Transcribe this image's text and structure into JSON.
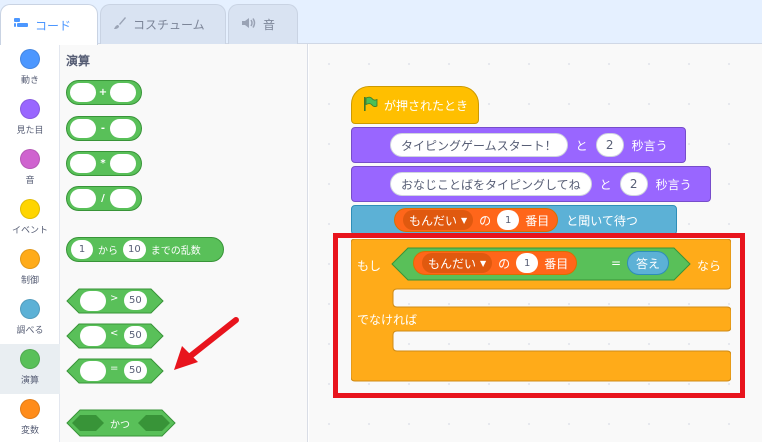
{
  "tabs": [
    {
      "label": "コード",
      "icon": "code-icon"
    },
    {
      "label": "コスチューム",
      "icon": "brush-icon"
    },
    {
      "label": "音",
      "icon": "speaker-icon"
    }
  ],
  "categories": [
    {
      "label": "動き",
      "color": "#4c97ff"
    },
    {
      "label": "見た目",
      "color": "#9966ff"
    },
    {
      "label": "音",
      "color": "#cf63cf"
    },
    {
      "label": "イベント",
      "color": "#ffd500"
    },
    {
      "label": "制御",
      "color": "#ffab19"
    },
    {
      "label": "調べる",
      "color": "#5cb1d6"
    },
    {
      "label": "演算",
      "color": "#59c059"
    },
    {
      "label": "変数",
      "color": "#ff8c1a"
    }
  ],
  "palette": {
    "title": "演算",
    "ops": [
      "+",
      "-",
      "*",
      "/"
    ],
    "random": {
      "from": "1",
      "word_from": "から",
      "to": "10",
      "word_to": "までの乱数"
    },
    "compare": [
      {
        "op": ">",
        "value": "50"
      },
      {
        "op": "<",
        "value": "50"
      },
      {
        "op": "=",
        "value": "50"
      }
    ],
    "and_label": "かつ"
  },
  "script": {
    "hat": "が押されたとき",
    "say1": {
      "text": "タイピングゲームスタート！",
      "word": "と",
      "secs": "2",
      "suffix": "秒言う"
    },
    "say2": {
      "text": "おなじことばをタイピングしてね",
      "word": "と",
      "secs": "2",
      "suffix": "秒言う"
    },
    "ask": {
      "list": "もんだい",
      "of": "の",
      "index": "1",
      "item": "番目",
      "suffix": "と聞いて待つ"
    },
    "if": {
      "if_word": "もし",
      "list": "もんだい",
      "of": "の",
      "index": "1",
      "item": "番目",
      "eq": "=",
      "answer": "答え",
      "then_word": "なら",
      "else_word": "でなければ"
    }
  },
  "colors": {
    "operators": "#59c059",
    "looks": "#9966ff",
    "control": "#ffab19",
    "sensing": "#5cb1d6",
    "lists": "#ff661a",
    "highlight": "#e8141d"
  }
}
